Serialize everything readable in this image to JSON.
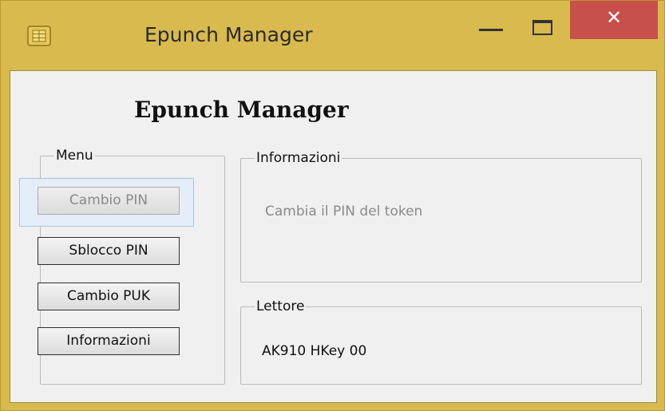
{
  "window": {
    "title": "Epunch Manager",
    "icon": "smartcard-chip-icon",
    "controls": {
      "minimize": "minimize-icon",
      "maximize": "maximize-icon",
      "close_label": "✕"
    },
    "accent_color": "#d8ba4e",
    "close_color": "#c7504a"
  },
  "header": {
    "title": "Epunch Manager"
  },
  "menu": {
    "legend": "Menu",
    "buttons": [
      {
        "label": "Cambio PIN",
        "state": "selected-disabled"
      },
      {
        "label": "Sblocco PIN",
        "state": "enabled"
      },
      {
        "label": "Cambio PUK",
        "state": "enabled"
      },
      {
        "label": "Informazioni",
        "state": "enabled"
      }
    ]
  },
  "info": {
    "legend": "Informazioni",
    "text": "Cambia il PIN del token"
  },
  "reader": {
    "legend": "Lettore",
    "value": "AK910 HKey 00"
  }
}
